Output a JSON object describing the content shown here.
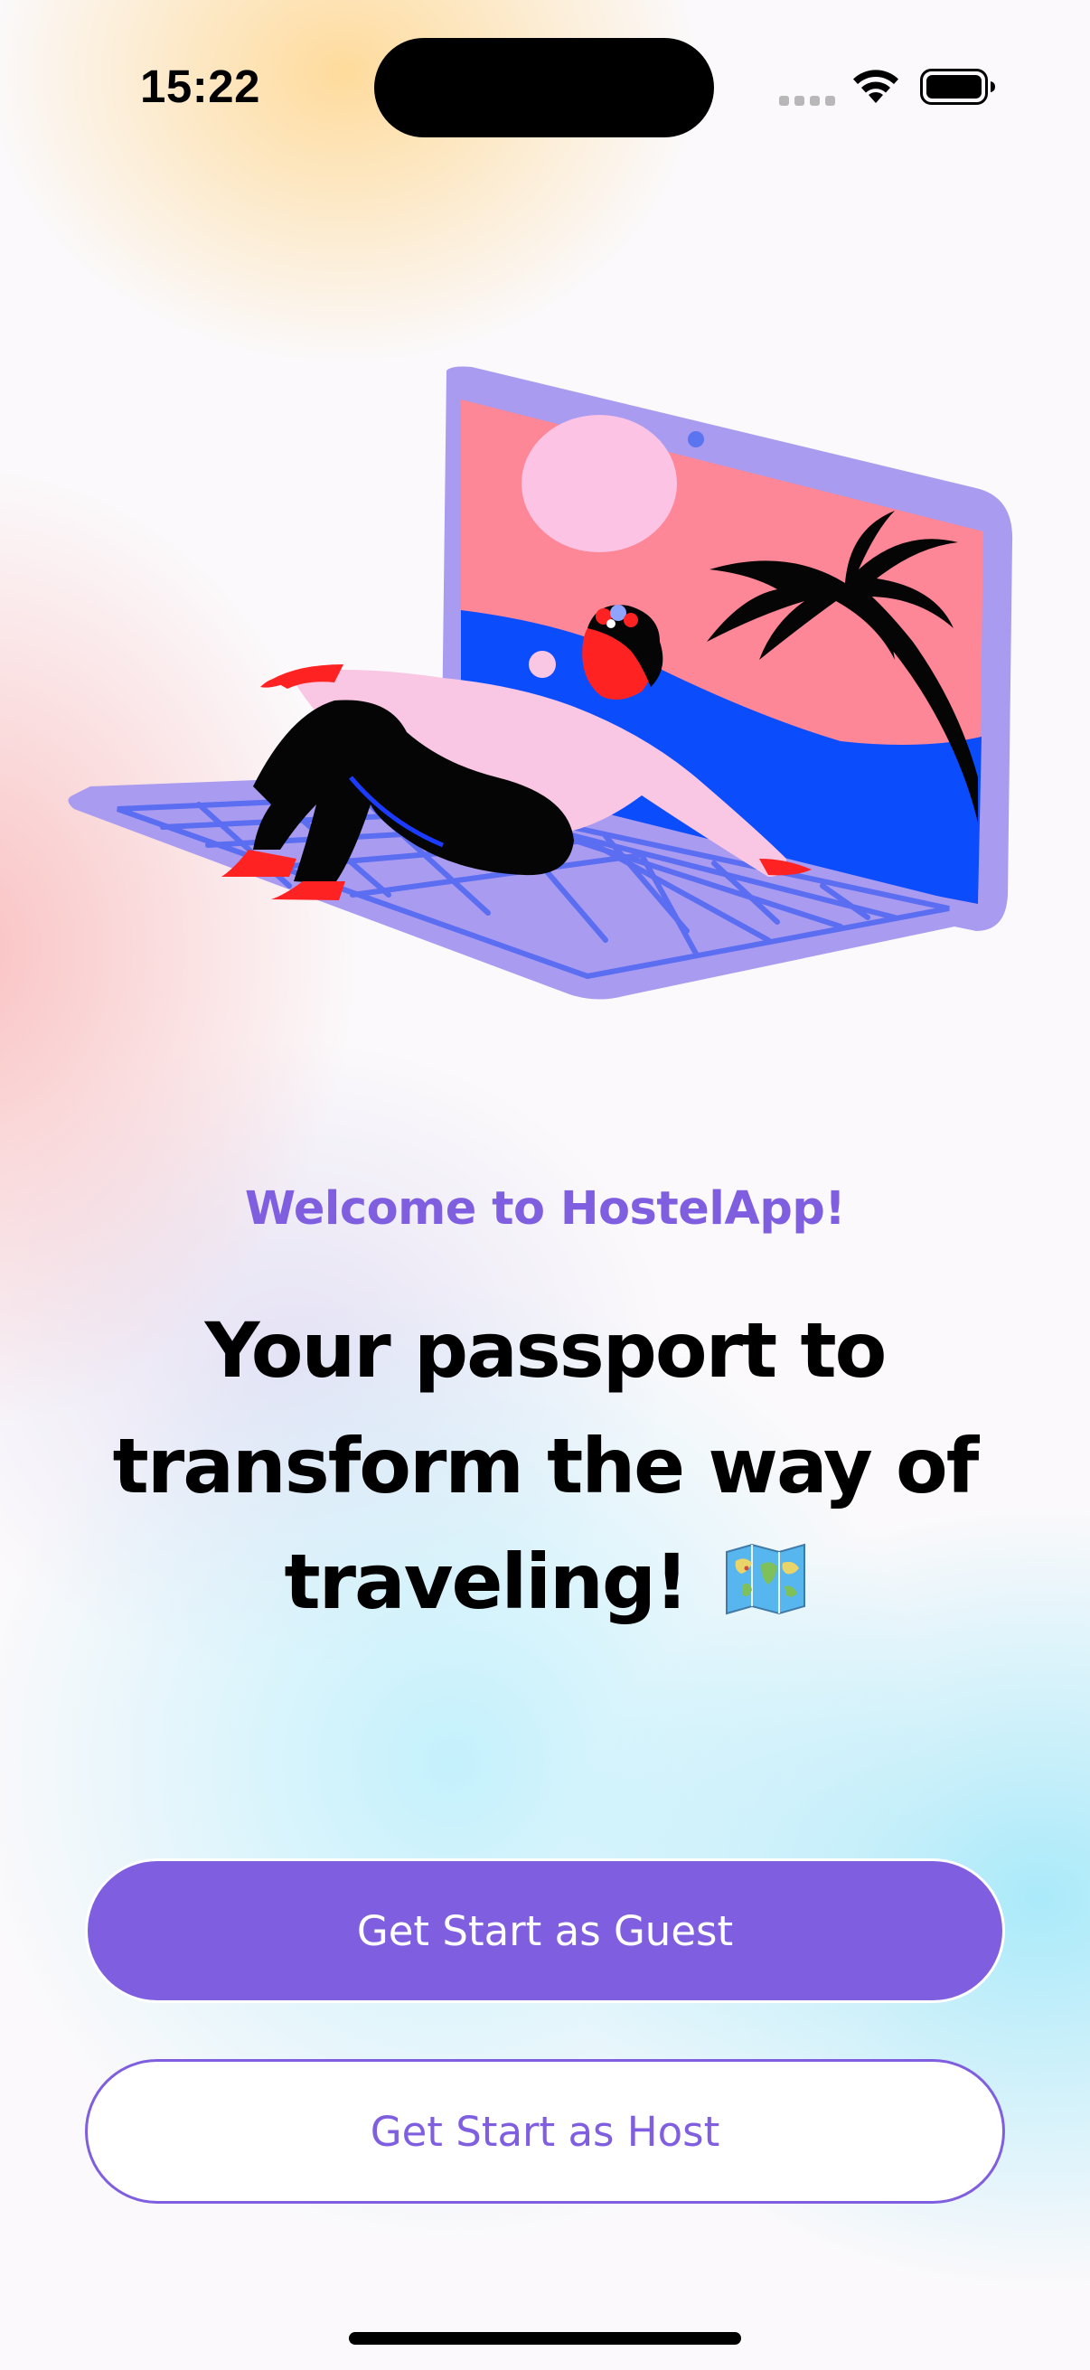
{
  "status_bar": {
    "time": "15:22",
    "icons": [
      "cellular-signal-icon",
      "wifi-icon",
      "battery-icon"
    ]
  },
  "illustration": {
    "name": "person-relaxing-on-laptop-illustration"
  },
  "welcome": {
    "subtitle": "Welcome to HostelApp!",
    "headline": "Your passport to transform the way of traveling!",
    "headline_icon": "world-map-icon"
  },
  "actions": {
    "guest_label": "Get Start as Guest",
    "host_label": "Get Start as Host"
  },
  "colors": {
    "accent": "#7f5fe0",
    "text_primary": "#000000",
    "button_text_light": "#ffffff"
  }
}
